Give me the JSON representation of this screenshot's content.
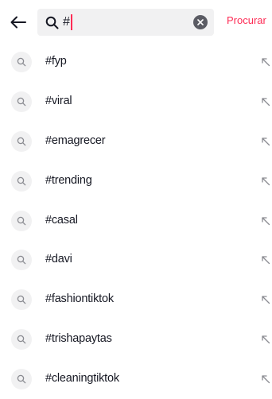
{
  "search": {
    "query": "#",
    "submit_label": "Procurar"
  },
  "suggestions": [
    {
      "label": "#fyp"
    },
    {
      "label": "#viral"
    },
    {
      "label": "#emagrecer"
    },
    {
      "label": "#trending"
    },
    {
      "label": "#casal"
    },
    {
      "label": "#davi"
    },
    {
      "label": "#fashiontiktok"
    },
    {
      "label": "#trishapaytas"
    },
    {
      "label": "#cleaningtiktok"
    }
  ],
  "icons": {
    "back": "arrow-left-icon",
    "search": "search-icon",
    "clear": "clear-icon",
    "fill": "arrow-up-left-icon"
  },
  "colors": {
    "accent": "#fe2c55",
    "text": "#161823",
    "field_bg": "#f1f1f2",
    "secondary": "#8a8b91"
  }
}
